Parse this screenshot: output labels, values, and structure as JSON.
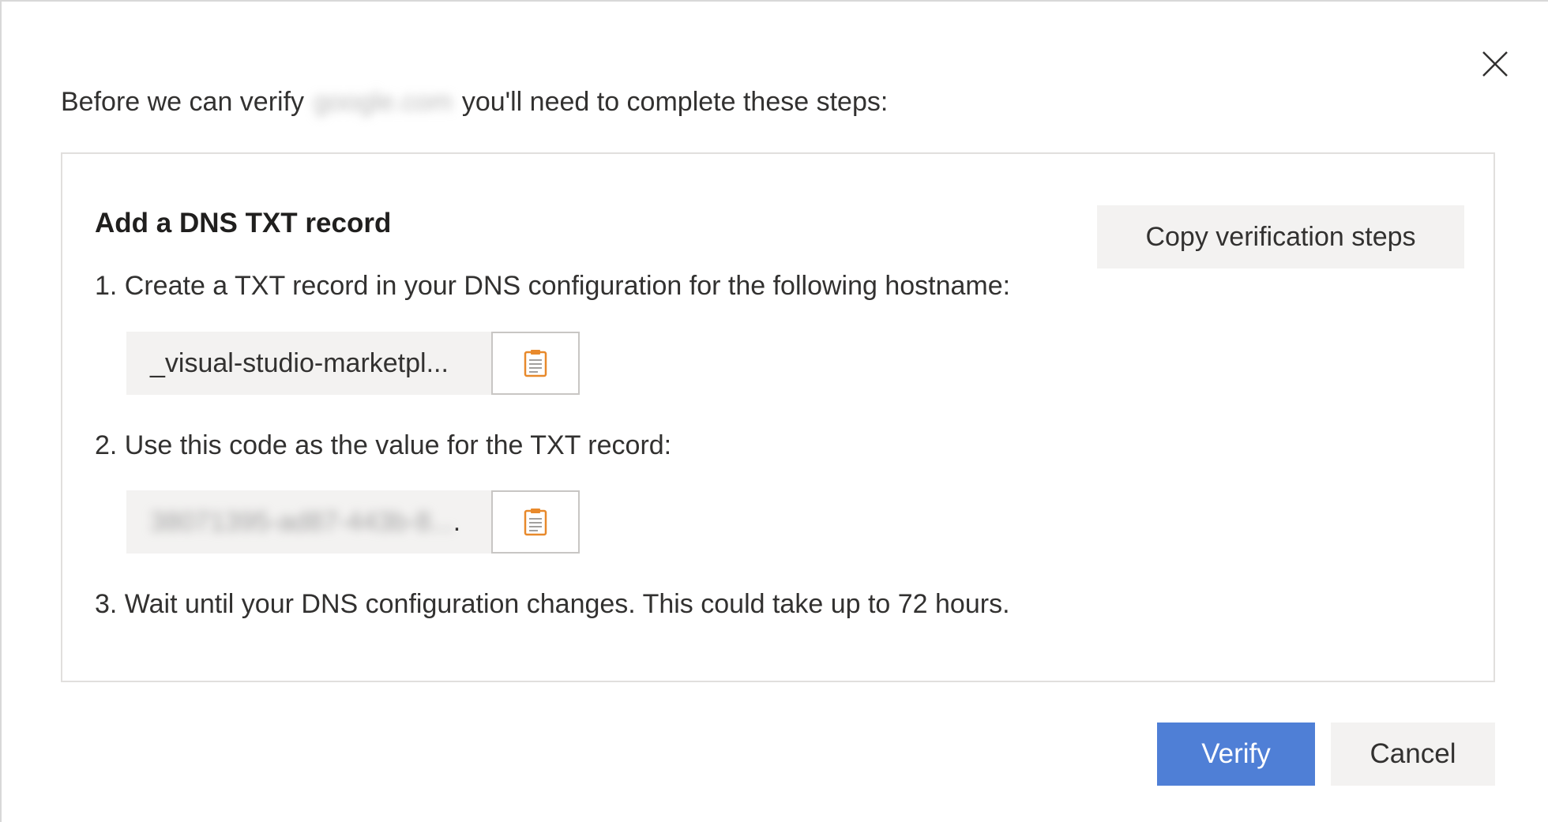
{
  "dialog": {
    "close_icon": "close-icon",
    "intro_before": "Before we can verify",
    "intro_domain": "google.com",
    "intro_after": "you'll need to complete these steps:"
  },
  "panel": {
    "title": "Add a DNS TXT record",
    "copy_steps_label": "Copy verification steps",
    "step1": "1. Create a TXT record in your DNS configuration for the following hostname:",
    "hostname_value": "_visual-studio-marketpl...",
    "step2": "2. Use this code as the value for the TXT record:",
    "code_value": "38071395-ad87-443b-8...",
    "code_suffix": ".",
    "step3": "3. Wait until your DNS configuration changes. This could take up to 72 hours.",
    "copy_icon": "clipboard-icon"
  },
  "footer": {
    "verify_label": "Verify",
    "cancel_label": "Cancel"
  },
  "colors": {
    "primary": "#4f7fd6",
    "neutral_bg": "#f3f2f1",
    "border": "#e1dfdd",
    "clipboard_accent": "#e8892b"
  }
}
